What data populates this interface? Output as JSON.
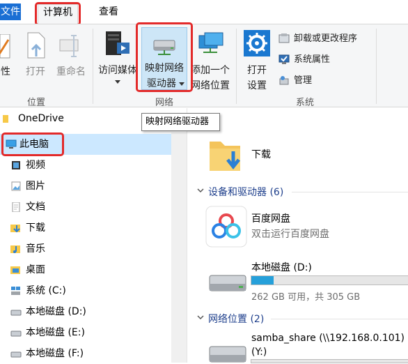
{
  "tabs": {
    "file": "文件",
    "computer": "计算机",
    "view": "查看"
  },
  "ribbon": {
    "properties": "性",
    "open": "打开",
    "rename": "重命名",
    "access_media": "访问媒体",
    "map_drive_line1": "映射网络",
    "map_drive_line2": "驱动器",
    "add_location_line1": "添加一个",
    "add_location_line2": "网络位置",
    "open_settings_line1": "打开",
    "open_settings_line2": "设置",
    "uninstall": "卸载或更改程序",
    "system_properties": "系统属性",
    "manage": "管理",
    "group_location": "位置",
    "group_network": "网络",
    "group_system": "系统"
  },
  "tooltip": "映射网络驱动器",
  "nav": {
    "onedrive": "OneDrive",
    "thispc": "此电脑",
    "videos": "视频",
    "pictures": "图片",
    "documents": "文档",
    "downloads": "下载",
    "music": "音乐",
    "desktop": "桌面",
    "drive_c": "系统 (C:)",
    "drive_d": "本地磁盘 (D:)",
    "drive_e": "本地磁盘 (E:)",
    "drive_f": "本地磁盘 (F:)"
  },
  "content": {
    "downloads": "下载",
    "devices_header": "设备和驱动器 (6)",
    "baidu_name": "百度网盘",
    "baidu_desc": "双击运行百度网盘",
    "drive_d_name": "本地磁盘 (D:)",
    "drive_d_usage": "262 GB 可用，共 305 GB",
    "drive_d_used_fraction": 0.14,
    "network_header": "网络位置 (2)",
    "samba_name": "samba_share (\\\\192.168.0.101)",
    "samba_letter": "(Y:)"
  },
  "colors": {
    "accent": "#1a6fd4",
    "selection": "#cce8ff",
    "highlight_box": "#e32a2a",
    "usage_bar": "#26a0da"
  }
}
